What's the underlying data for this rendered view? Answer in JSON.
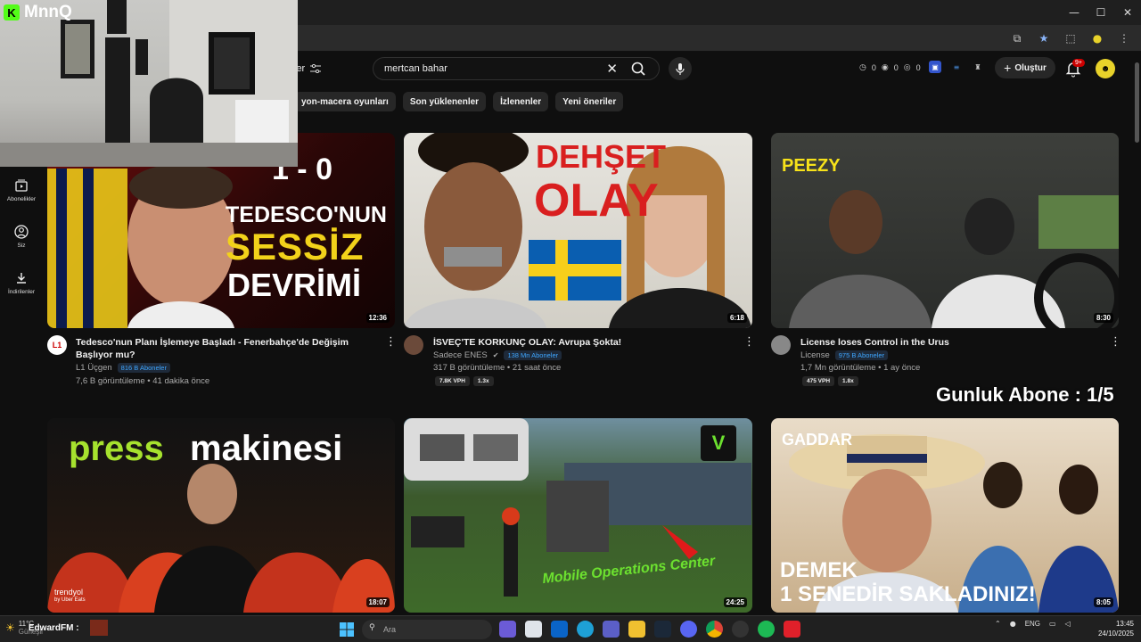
{
  "browser": {
    "controls": {
      "minimize": "—",
      "maximize": "☐",
      "close": "✕"
    }
  },
  "header": {
    "filter_label": "ler",
    "search": {
      "value": "mertcan bahar",
      "clear": "✕"
    },
    "counters": [
      "0",
      "0",
      "0"
    ],
    "create_label": "Oluştur",
    "notifications": "9+"
  },
  "chips": [
    "yon-macera oyunları",
    "Son yüklenenler",
    "İzlenenler",
    "Yeni öneriler"
  ],
  "sidebar": [
    {
      "label": "Abonelikler",
      "icon": "subscriptions-icon"
    },
    {
      "label": "Siz",
      "icon": "you-icon"
    },
    {
      "label": "İndirilenler",
      "icon": "downloads-icon"
    }
  ],
  "webcam": {
    "brand": "MnnQ"
  },
  "overlay": {
    "subscribers": "Gunluk Abone : 1/5"
  },
  "videos": [
    {
      "thumb_text": [
        "TEDESCO'NUN",
        "SESSİZ",
        "DEVRİMİ"
      ],
      "thumb_score": "1 - 0",
      "duration": "12:36",
      "title": "Tedesco'nun Planı İşlemeye Başladı - Fenerbahçe'de Değişim Başlıyor mu?",
      "channel": "L1 Üçgen",
      "channel_initial": "L1",
      "subs": "816 B Aboneler",
      "meta": "7,6 B görüntüleme • 41 dakika önce",
      "badges": []
    },
    {
      "thumb_text": [
        "DEHŞET",
        "OLAY"
      ],
      "duration": "6:18",
      "title": "İSVEÇ'TE KORKUNÇ OLAY: Avrupa Şokta!",
      "channel": "Sadece ENES",
      "subs": "138 Mn Aboneler",
      "meta": "317 B görüntüleme • 21 saat önce",
      "badges": [
        "7.8K VPH",
        "1.3x"
      ]
    },
    {
      "thumb_text": [
        "PEEZY"
      ],
      "duration": "8:30",
      "title": "License loses Control in the Urus",
      "channel": "License",
      "subs": "975 B Aboneler",
      "meta": "1,7 Mn görüntüleme • 1 ay önce",
      "badges": [
        "475 VPH",
        "1.8x"
      ]
    },
    {
      "thumb_text": [
        "press",
        "makinesi",
        "trendyol",
        "by Uber Eats"
      ],
      "duration": "18:07"
    },
    {
      "thumb_text": [
        "Mobile Operations Center",
        "V"
      ],
      "duration": "24:25"
    },
    {
      "thumb_text": [
        "GADDAR",
        "DEMEK",
        "1 SENEDİR SAKLADINIZ!"
      ],
      "duration": "8:05"
    }
  ],
  "taskbar": {
    "weather": "11°C",
    "weather_sub": "Güneşli",
    "stream_label": "EdwardFM :",
    "search_placeholder": "Ara",
    "lang": "ENG",
    "time": "13:45",
    "date": "24/10/2025"
  },
  "colors": {
    "accent": "#cc0000",
    "badge_blue": "#3ea6ff",
    "kick_green": "#53fc18"
  }
}
